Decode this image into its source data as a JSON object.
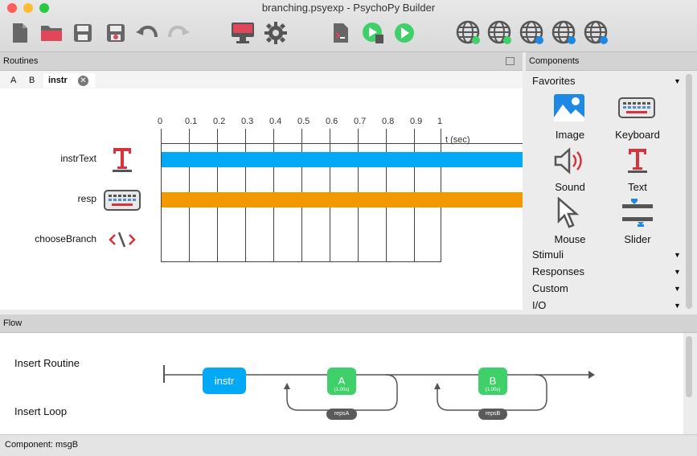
{
  "window": {
    "title": "branching.psyexp - PsychoPy Builder"
  },
  "toolbar": {
    "icons": [
      "new-file-icon",
      "open-folder-icon",
      "save-icon",
      "save-as-icon",
      "undo-icon",
      "redo-icon",
      "monitor-icon",
      "gear-icon",
      "compile-script-icon",
      "run-pilot-icon",
      "run-icon",
      "globe-sync-icon",
      "globe-run-icon",
      "globe-search-icon",
      "globe-user-icon",
      "globe-info-icon"
    ]
  },
  "routines": {
    "header": "Routines",
    "tabs": [
      "A",
      "B",
      "instr"
    ],
    "active_tab": "instr",
    "time_ticks": [
      "0",
      "0.1",
      "0.2",
      "0.3",
      "0.4",
      "0.5",
      "0.6",
      "0.7",
      "0.8",
      "0.9",
      "1"
    ],
    "time_unit": "t (sec)",
    "rows": [
      {
        "label": "instrText",
        "icon": "text-icon",
        "bar_color": "#03a9f4"
      },
      {
        "label": "resp",
        "icon": "keyboard-icon",
        "bar_color": "#f49800"
      },
      {
        "label": "chooseBranch",
        "icon": "code-icon",
        "bar_color": ""
      }
    ]
  },
  "components": {
    "header": "Components",
    "favorites_label": "Favorites",
    "favorites": [
      {
        "label": "Image",
        "icon": "image-icon"
      },
      {
        "label": "Keyboard",
        "icon": "keyboard-icon"
      },
      {
        "label": "Sound",
        "icon": "speaker-icon"
      },
      {
        "label": "Text",
        "icon": "text-icon"
      },
      {
        "label": "Mouse",
        "icon": "mouse-cursor-icon"
      },
      {
        "label": "Slider",
        "icon": "slider-icon"
      }
    ],
    "categories": [
      "Stimuli",
      "Responses",
      "Custom",
      "I/O"
    ]
  },
  "flow": {
    "header": "Flow",
    "insert_routine": "Insert Routine",
    "insert_loop": "Insert Loop",
    "routines": [
      {
        "name": "instr",
        "color": "#03a9f4",
        "duration": ""
      },
      {
        "name": "A",
        "color": "#3fd06a",
        "duration": "(1.00s)"
      },
      {
        "name": "B",
        "color": "#3fd06a",
        "duration": "(1.00s)"
      }
    ],
    "loops": [
      "repsA",
      "repsB"
    ]
  },
  "status": {
    "text": "Component: msgB"
  },
  "colors": {
    "text_red": "#d6333d",
    "accent_blue": "#03a9f4",
    "accent_orange": "#f49800",
    "green": "#3fd06a"
  }
}
